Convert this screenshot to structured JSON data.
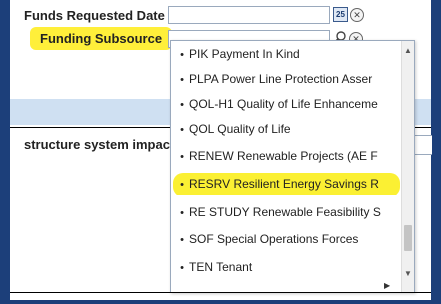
{
  "form": {
    "funds_requested_date_label": "Funds Requested Date",
    "funding_subsource_label": "Funding Subsource",
    "calendar_button_label": "25",
    "structure_label": "structure system impac"
  },
  "dropdown": {
    "options": [
      {
        "label": "PIK Payment In Kind"
      },
      {
        "label": "PLPA Power Line Protection Asser"
      },
      {
        "label": "QOL-H1 Quality of Life Enhanceme"
      },
      {
        "label": "QOL Quality of Life"
      },
      {
        "label": "RENEW Renewable Projects (AE F"
      },
      {
        "label": "RESRV Resilient Energy Savings R",
        "highlighted": true
      },
      {
        "label": "RE STUDY Renewable Feasibility S"
      },
      {
        "label": "SOF Special Operations Forces"
      },
      {
        "label": "TEN Tenant"
      }
    ],
    "bullet": "•"
  },
  "colors": {
    "frame": "#1c3f7a",
    "highlight": "#fbf033",
    "band": "#cfe0f2"
  }
}
